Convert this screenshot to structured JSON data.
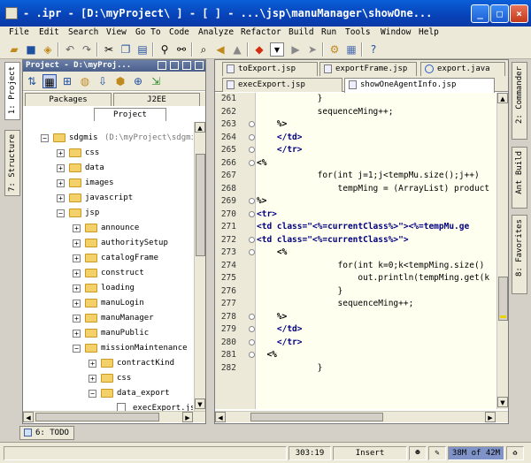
{
  "window": {
    "title": "- .ipr - [D:\\myProject\\        ] - [       ] - ...\\jsp\\manuManager\\showOne...",
    "minimize": "_",
    "maximize": "□",
    "close": "×"
  },
  "menu": [
    "File",
    "Edit",
    "Search",
    "View",
    "Go To",
    "Code",
    "Analyze",
    "Refactor",
    "Build",
    "Run",
    "Tools",
    "Window",
    "Help"
  ],
  "left_tabs": {
    "project": "1: Project",
    "structure": "7: Structure"
  },
  "right_tabs": {
    "commander": "2: Commander",
    "ant_build": "Ant Build",
    "favorites": "8: Favorites"
  },
  "project_panel": {
    "header": "Project - D:\\myProj...",
    "tab_packages": "Packages",
    "tab_j2ee": "J2EE",
    "tab_project": "Project",
    "tree": [
      {
        "label": "sdgmis",
        "suffix": "(D:\\myProject\\sdgmis",
        "type": "folder",
        "expanded": true
      },
      {
        "label": "css",
        "type": "folder"
      },
      {
        "label": "data",
        "type": "folder"
      },
      {
        "label": "images",
        "type": "folder"
      },
      {
        "label": "javascript",
        "type": "folder"
      },
      {
        "label": "jsp",
        "type": "folder",
        "expanded": true
      },
      {
        "label": "announce",
        "type": "folder"
      },
      {
        "label": "authoritySetup",
        "type": "folder"
      },
      {
        "label": "catalogFrame",
        "type": "folder"
      },
      {
        "label": "construct",
        "type": "folder"
      },
      {
        "label": "loading",
        "type": "folder"
      },
      {
        "label": "manuLogin",
        "type": "folder"
      },
      {
        "label": "manuManager",
        "type": "folder"
      },
      {
        "label": "manuPublic",
        "type": "folder"
      },
      {
        "label": "missionMaintenance",
        "type": "folder",
        "expanded": true
      },
      {
        "label": "contractKind",
        "type": "folder"
      },
      {
        "label": "css",
        "type": "folder"
      },
      {
        "label": "data_export",
        "type": "folder",
        "expanded": true
      },
      {
        "label": "execExport.jsp",
        "type": "file"
      }
    ]
  },
  "editor": {
    "tabs_row1": [
      "toExport.jsp",
      "exportFrame.jsp",
      "export.java"
    ],
    "tabs_row2": [
      "execExport.jsp",
      "showOneAgentInfo.jsp"
    ],
    "active_tab": "showOneAgentInfo.jsp",
    "lines": [
      {
        "n": "261",
        "text": "            }"
      },
      {
        "n": "262",
        "text": "            sequenceMing++;"
      },
      {
        "n": "263",
        "text": "    %>"
      },
      {
        "n": "264",
        "text": "    </td>"
      },
      {
        "n": "265",
        "text": "    </tr>"
      },
      {
        "n": "266",
        "text": "<%"
      },
      {
        "n": "267",
        "text": "            for(int j=1;j<tempMu.size();j++)"
      },
      {
        "n": "268",
        "text": "                tempMing = (ArrayList) product"
      },
      {
        "n": "269",
        "text": "%>"
      },
      {
        "n": "270",
        "text": "<tr>"
      },
      {
        "n": "271",
        "text": "<td class=\"<%=currentClass%>\"><%=tempMu.ge"
      },
      {
        "n": "272",
        "text": "<td class=\"<%=currentClass%>\">"
      },
      {
        "n": "273",
        "text": "    <%"
      },
      {
        "n": "274",
        "text": "                for(int k=0;k<tempMing.size()"
      },
      {
        "n": "275",
        "text": "                    out.println(tempMing.get(k"
      },
      {
        "n": "276",
        "text": "                }"
      },
      {
        "n": "277",
        "text": "                sequenceMing++;"
      },
      {
        "n": "278",
        "text": "    %>"
      },
      {
        "n": "279",
        "text": "    </td>"
      },
      {
        "n": "280",
        "text": "    </tr>"
      },
      {
        "n": "281",
        "text": "  <%"
      },
      {
        "n": "282",
        "text": "            }"
      }
    ]
  },
  "todo_button": "6: TODO",
  "status": {
    "position": "303:19",
    "mode": "Insert",
    "memory": "38M of 42M"
  }
}
